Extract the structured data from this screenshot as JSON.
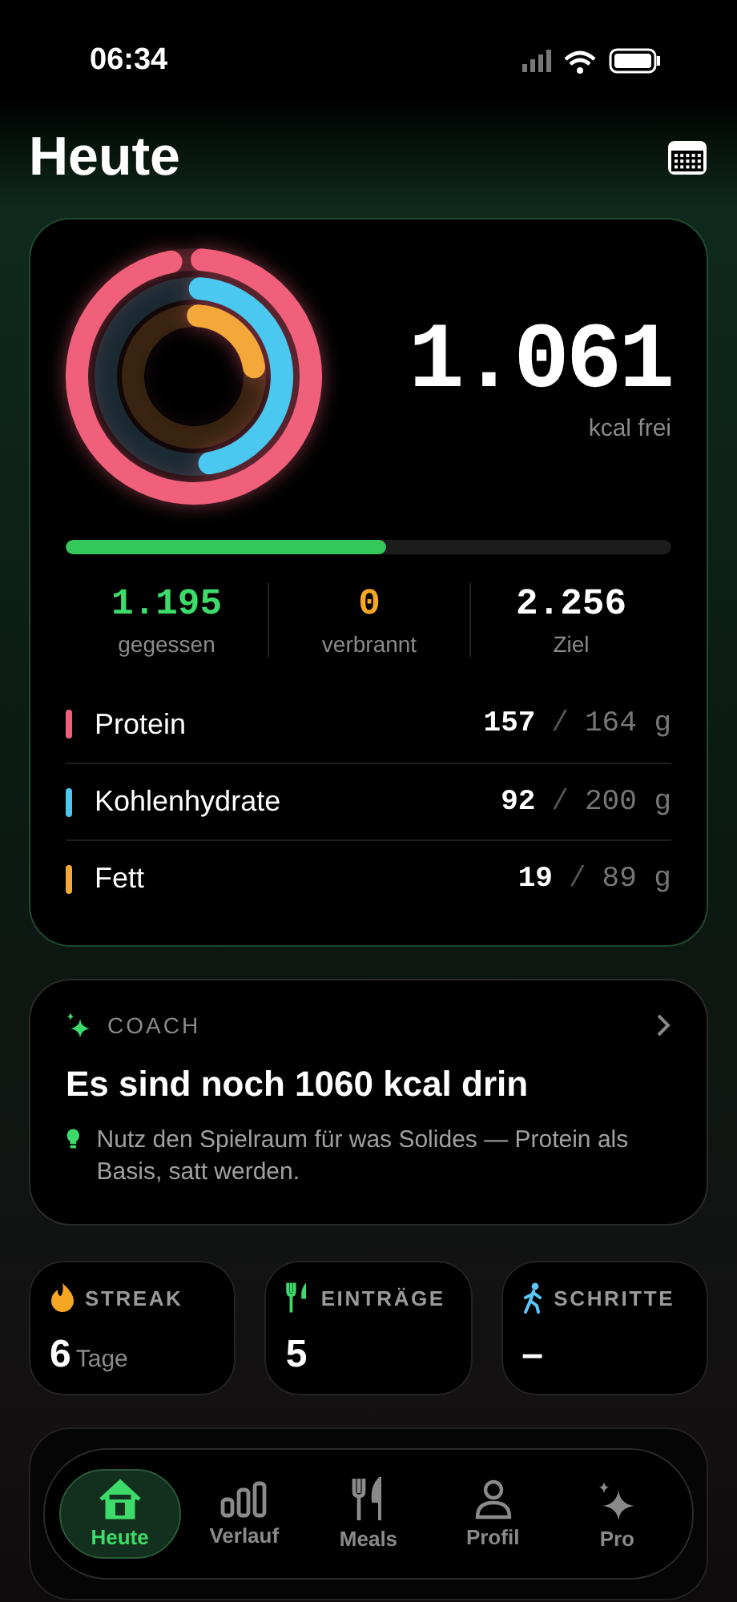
{
  "status_bar": {
    "time": "06:34"
  },
  "header": {
    "title": "Heute"
  },
  "summary": {
    "remaining": "1.061",
    "remaining_label": "kcal frei",
    "level": 0.53,
    "stats": [
      {
        "value": "1.195",
        "label": "gegessen",
        "color": "#3ddc6a"
      },
      {
        "value": "0",
        "label": "verbrannt",
        "color": "#f5a623"
      },
      {
        "value": "2.256",
        "label": "Ziel",
        "color": "#ffffff"
      }
    ],
    "macros": [
      {
        "name": "Protein",
        "eaten": "157",
        "separator": "/",
        "goal": "164 g",
        "color": "#f0607a"
      },
      {
        "name": "Kohlenhydrate",
        "eaten": "92",
        "separator": "/",
        "goal": "200 g",
        "color": "#4ac8f0"
      },
      {
        "name": "Fett",
        "eaten": "19",
        "separator": "/",
        "goal": "89 g",
        "color": "#f5a83a"
      }
    ]
  },
  "coach": {
    "label": "COACH",
    "headline": "Es sind noch 1060 kcal drin",
    "tip": "Nutz den Spielraum für was Solides — Protein als Basis, satt werden."
  },
  "tiles": [
    {
      "kind": "streak",
      "label": "STREAK",
      "value": "6",
      "unit": "Tage"
    },
    {
      "kind": "entries",
      "label": "EINTRÄGE",
      "value": "5"
    },
    {
      "kind": "steps",
      "label": "SCHRITTE",
      "value": "–"
    }
  ],
  "tab_bar": [
    {
      "kind": "home",
      "label": "Heute",
      "selected": true
    },
    {
      "kind": "history",
      "label": "Verlauf",
      "selected": false
    },
    {
      "kind": "meals",
      "label": "Meals",
      "selected": false
    },
    {
      "kind": "profile",
      "label": "Profil",
      "selected": false
    },
    {
      "kind": "pro",
      "label": "Pro",
      "selected": false
    }
  ]
}
